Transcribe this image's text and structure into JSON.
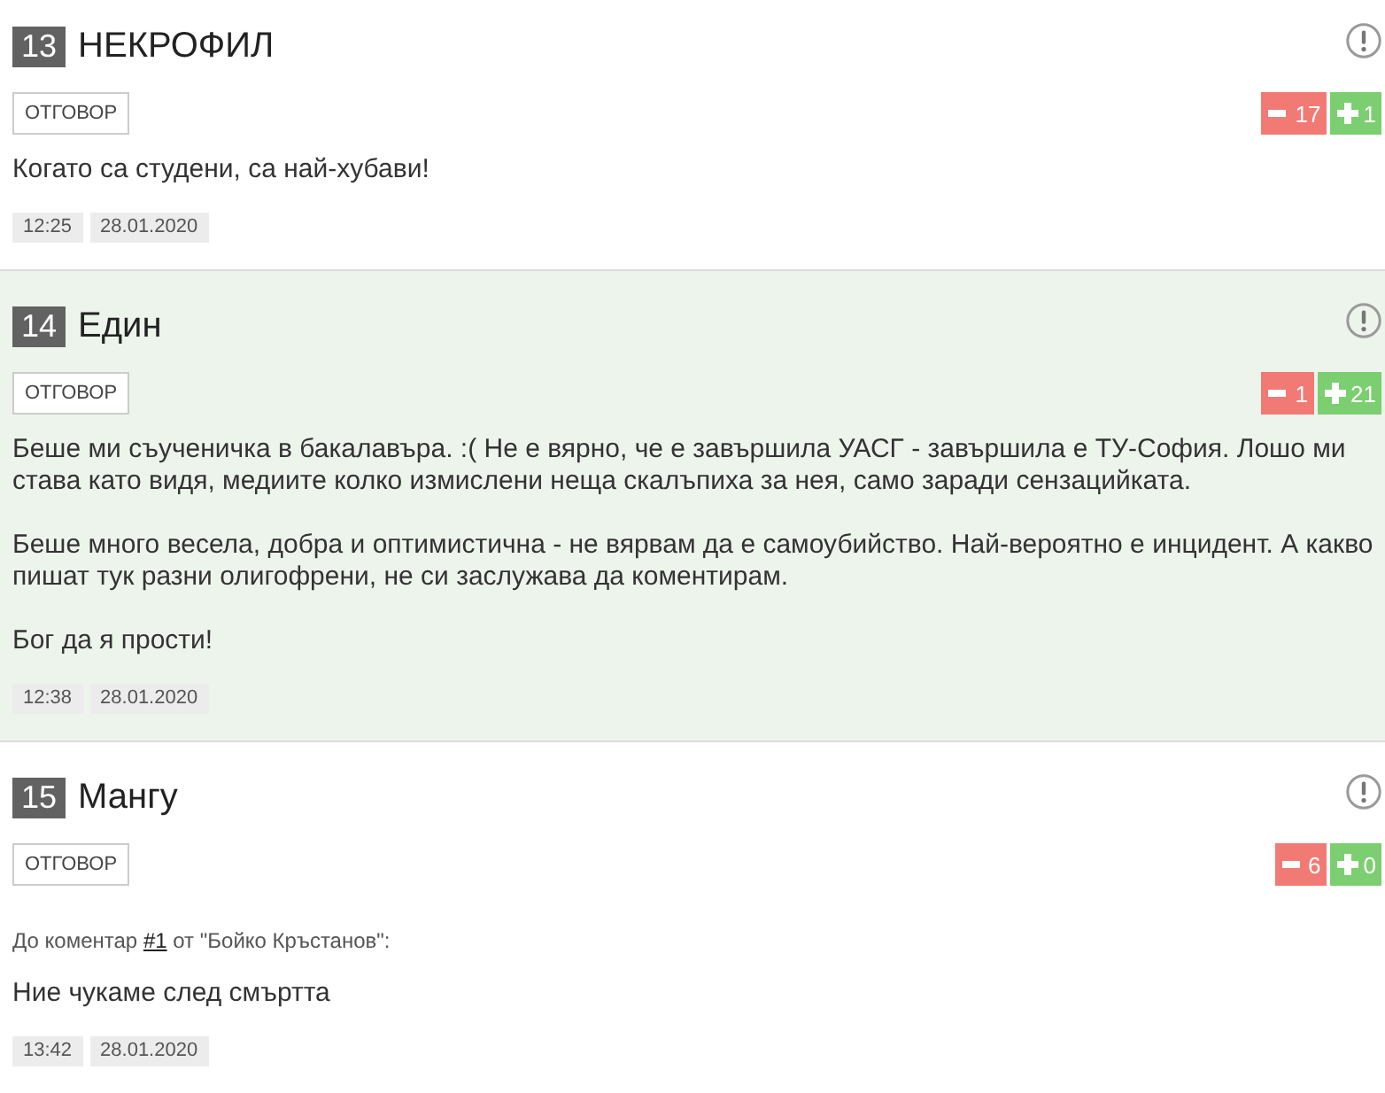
{
  "comments": [
    {
      "number": "13",
      "author": "НЕКРОФИЛ",
      "highlighted": false,
      "reply_button": "ОТГОВОР",
      "downvotes": "17",
      "upvotes": "1",
      "paragraphs": [
        "Когато са студени, са най-хубави!"
      ],
      "time": "12:25",
      "date": "28.01.2020"
    },
    {
      "number": "14",
      "author": "Един",
      "highlighted": true,
      "reply_button": "ОТГОВОР",
      "downvotes": "1",
      "upvotes": "21",
      "paragraphs": [
        "Беше ми съученичка в бакалавъра. :( Не е вярно, че е завършила УАСГ - завършила е ТУ-София. Лошо ми става като видя, медиите колко измислени неща скалъпиха за нея, само заради сензацийката.",
        "Беше много весела, добра и оптимистична - не вярвам да е самоубийство. Най-вероятно е инцидент. А какво пишат тук разни олигофрени, не си заслужава да коментирам.",
        "Бог да я прости!"
      ],
      "time": "12:38",
      "date": "28.01.2020"
    },
    {
      "number": "15",
      "author": "Мангу",
      "highlighted": false,
      "reply_button": "ОТГОВОР",
      "downvotes": "6",
      "upvotes": "0",
      "reply_to": {
        "prefix": "До коментар",
        "link": "#1",
        "suffix": "от \"Бойко Кръстанов\":"
      },
      "paragraphs": [
        "Ние чукаме след смъртта"
      ],
      "time": "13:42",
      "date": "28.01.2020"
    }
  ]
}
